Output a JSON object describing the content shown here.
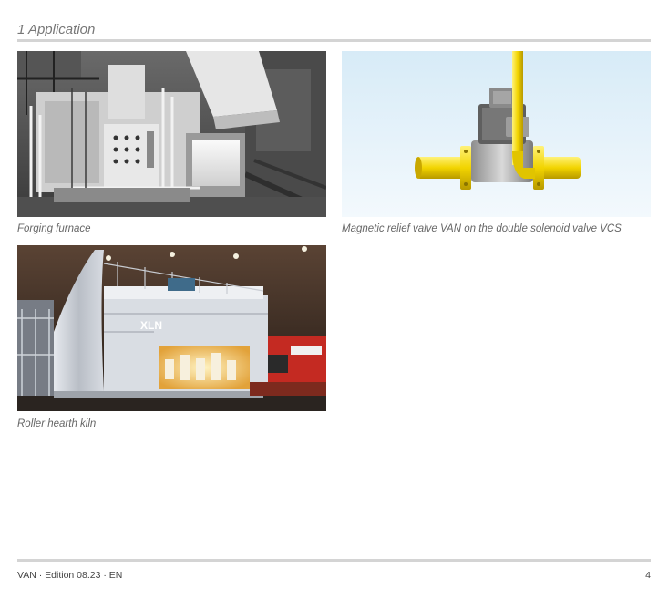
{
  "section": {
    "title": "1 Application"
  },
  "figures": [
    {
      "caption": "Forging furnace"
    },
    {
      "caption": "Magnetic relief valve VAN on the double solenoid valve VCS"
    },
    {
      "caption": "Roller hearth kiln",
      "sign_text": "XLN"
    }
  ],
  "footer": {
    "doc": "VAN · Edition 08.23 · EN",
    "page": "4"
  }
}
